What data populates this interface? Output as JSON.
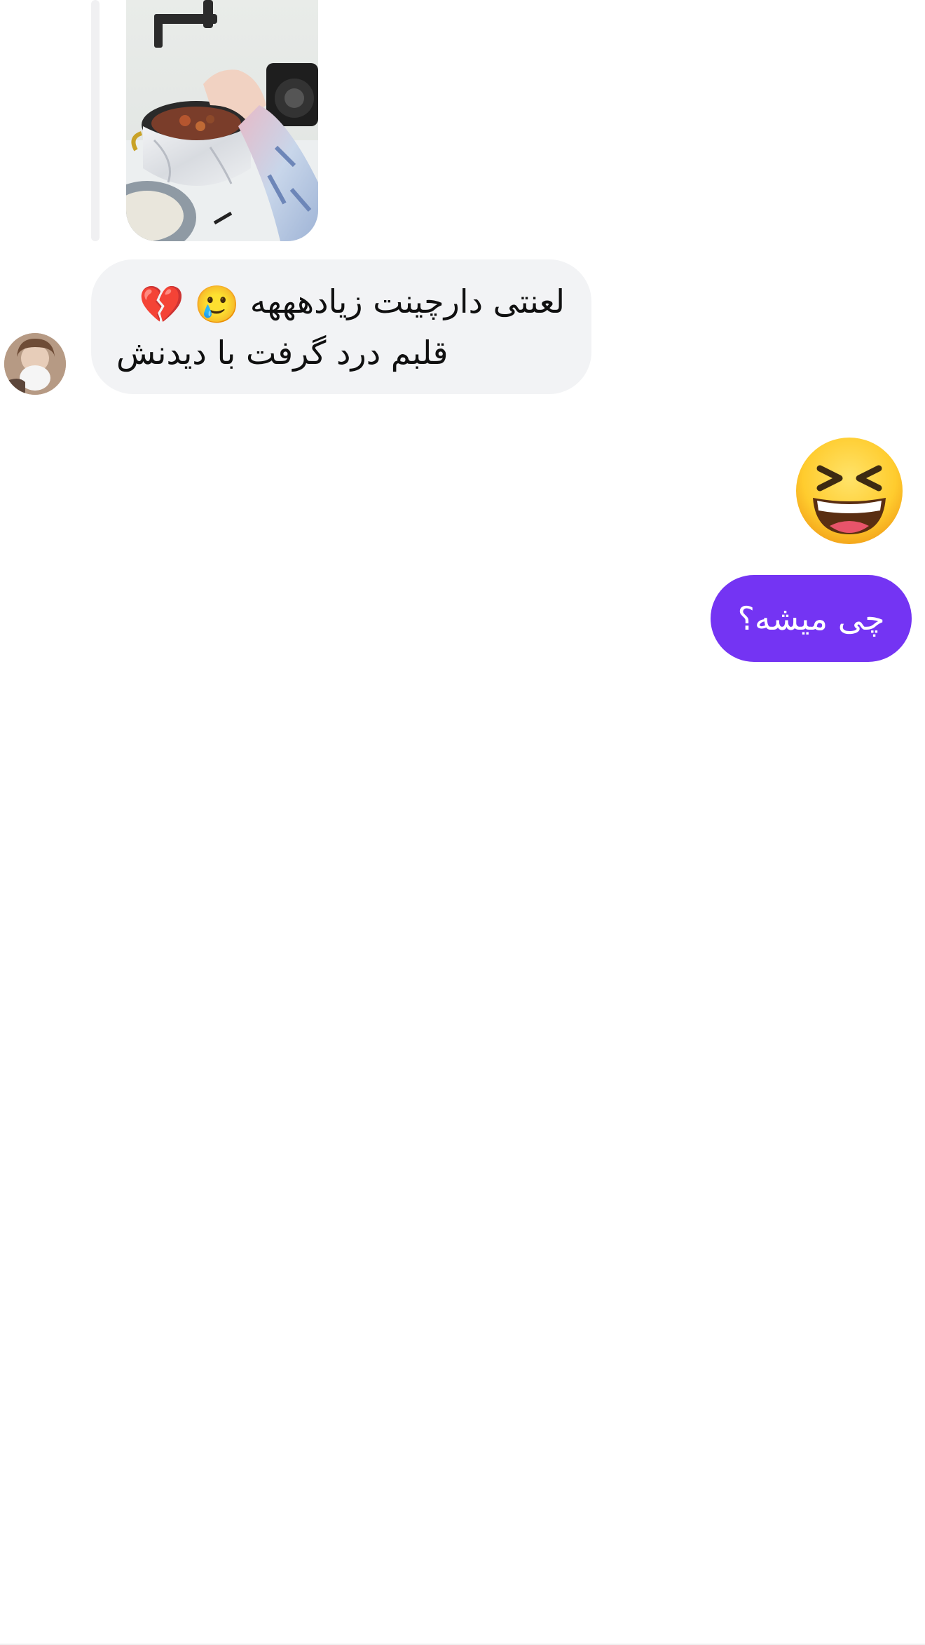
{
  "conversation": {
    "shared_media": {
      "icon": "video-thumbnail-cooking-pot"
    },
    "incoming_message": {
      "line1": "لعنتی دارچینت زیادهههه",
      "line1_emojis": [
        "🥲",
        "💔"
      ],
      "line2": "قلبم درد گرفت با دیدنش",
      "avatar_icon": "user-avatar-photo"
    },
    "outgoing_emoji": {
      "icon": "grinning-squinting-face-emoji"
    },
    "outgoing_message": {
      "text": "چی میشه؟"
    },
    "colors": {
      "incoming_bubble": "#f2f3f5",
      "outgoing_bubble": "#7434f3",
      "reply_bar": "#f0f0f2"
    }
  }
}
